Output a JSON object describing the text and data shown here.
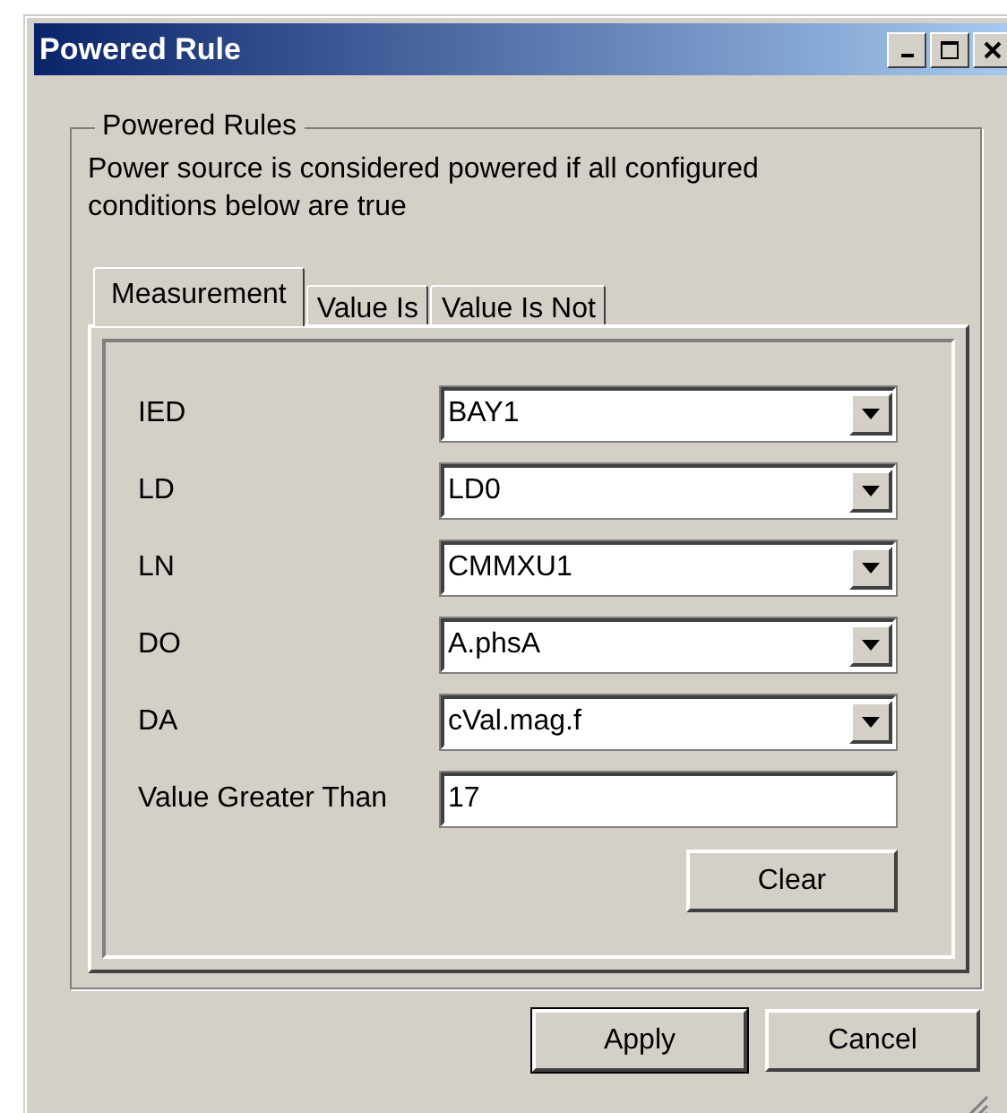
{
  "window": {
    "title": "Powered Rule"
  },
  "group": {
    "legend": "Powered Rules",
    "description": "Power source is considered powered if all configured conditions below are true"
  },
  "tabs": [
    {
      "label": "Measurement",
      "selected": true
    },
    {
      "label": "Value Is",
      "selected": false
    },
    {
      "label": "Value Is Not",
      "selected": false
    }
  ],
  "fields": [
    {
      "label": "IED",
      "kind": "dropdown",
      "value": "BAY1"
    },
    {
      "label": "LD",
      "kind": "dropdown",
      "value": "LD0"
    },
    {
      "label": "LN",
      "kind": "dropdown",
      "value": "CMMXU1"
    },
    {
      "label": "DO",
      "kind": "dropdown",
      "value": "A.phsA"
    },
    {
      "label": "DA",
      "kind": "dropdown",
      "value": "cVal.mag.f"
    },
    {
      "label": "Value Greater Than",
      "kind": "text",
      "value": "17"
    }
  ],
  "clear_button": "Clear",
  "buttons": [
    {
      "label": "Apply",
      "default": true
    },
    {
      "label": "Cancel",
      "default": false
    }
  ]
}
